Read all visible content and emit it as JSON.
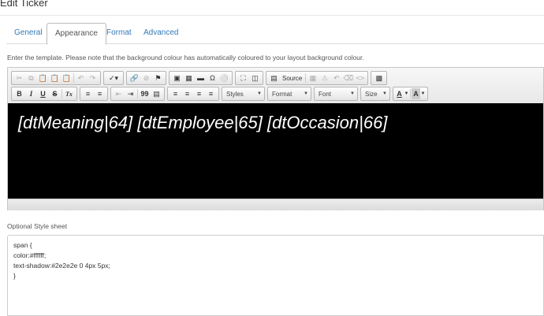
{
  "page": {
    "title": "Edit Ticker"
  },
  "tabs": [
    {
      "label": "General"
    },
    {
      "label": "Appearance",
      "active": true
    },
    {
      "label": "Format"
    },
    {
      "label": "Advanced"
    }
  ],
  "hint": "Enter the template. Please note that the background colour has automatically coloured to your layout background colour.",
  "toolbar": {
    "source_label": "Source",
    "bold": "B",
    "italic": "I",
    "underline": "U",
    "strike": "S",
    "clear_format": "Tx",
    "blockquote": "99",
    "styles_label": "Styles",
    "format_label": "Format",
    "font_label": "Font",
    "size_label": "Size",
    "text_color": "A",
    "bg_color": "A"
  },
  "editor": {
    "content": "[dtMeaning|64] [dtEmployee|65] [dtOccasion|66]",
    "background": "#000000",
    "text_color": "#ffffff"
  },
  "stylesheet": {
    "label": "Optional Style sheet",
    "value": "span {\ncolor:#ffffff;\ntext-shadow:#2e2e2e 0 4px 5px;\n}"
  }
}
